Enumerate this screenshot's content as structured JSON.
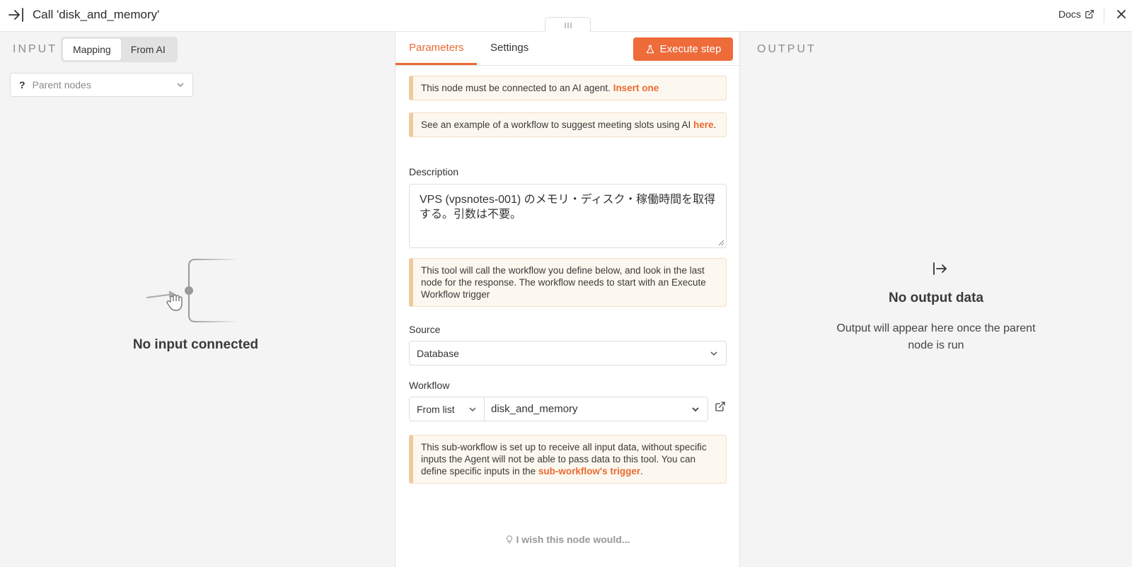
{
  "header": {
    "title": "Call 'disk_and_memory'",
    "docs_label": "Docs"
  },
  "input_panel": {
    "label": "INPUT",
    "modes": [
      "Mapping",
      "From AI"
    ],
    "active_mode": "Mapping",
    "parent_nodes_placeholder": "Parent nodes",
    "empty_state": "No input connected"
  },
  "params_panel": {
    "tabs": [
      "Parameters",
      "Settings"
    ],
    "active_tab": "Parameters",
    "execute_label": "Execute step",
    "notice_agent": {
      "text": "This node must be connected to an AI agent. ",
      "link": "Insert one"
    },
    "notice_example": {
      "text": "See an example of a workflow to suggest meeting slots using AI ",
      "link": "here",
      "end": "."
    },
    "description_label": "Description",
    "description_value": "VPS (vpsnotes-001) のメモリ・ディスク・稼働時間を取得する。引数は不要。",
    "notice_tool": "This tool will call the workflow you define below, and look in the last node for the response. The workflow needs to start with an Execute Workflow trigger",
    "source_label": "Source",
    "source_value": "Database",
    "workflow_label": "Workflow",
    "workflow_mode": "From list",
    "workflow_value": "disk_and_memory",
    "notice_subworkflow": {
      "text": "This sub-workflow is set up to receive all input data, without specific inputs the Agent will not be able to pass data to this tool. You can define specific inputs in the ",
      "link": "sub-workflow's trigger",
      "end": "."
    },
    "wish_label": "I wish this node would..."
  },
  "output_panel": {
    "label": "OUTPUT",
    "empty_title": "No output data",
    "empty_subtitle": "Output will appear here once the parent node is run"
  },
  "colors": {
    "accent": "#ea6a33",
    "button": "#ee6b3a",
    "notice_bg": "#fdf8ef",
    "panel_bg": "#f4f4f4"
  }
}
